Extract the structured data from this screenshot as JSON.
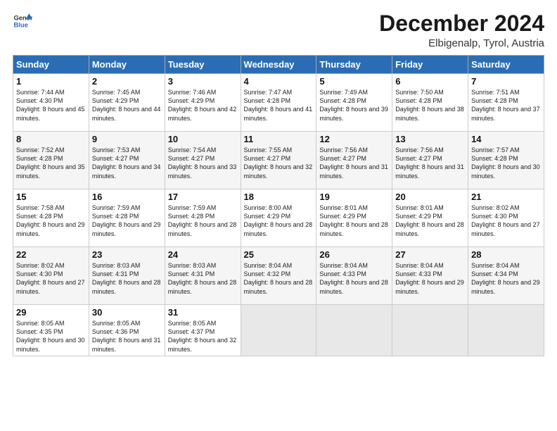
{
  "logo": {
    "line1": "General",
    "line2": "Blue"
  },
  "title": "December 2024",
  "location": "Elbigenalp, Tyrol, Austria",
  "weekdays": [
    "Sunday",
    "Monday",
    "Tuesday",
    "Wednesday",
    "Thursday",
    "Friday",
    "Saturday"
  ],
  "weeks": [
    [
      {
        "day": "1",
        "sunrise": "Sunrise: 7:44 AM",
        "sunset": "Sunset: 4:30 PM",
        "daylight": "Daylight: 8 hours and 45 minutes."
      },
      {
        "day": "2",
        "sunrise": "Sunrise: 7:45 AM",
        "sunset": "Sunset: 4:29 PM",
        "daylight": "Daylight: 8 hours and 44 minutes."
      },
      {
        "day": "3",
        "sunrise": "Sunrise: 7:46 AM",
        "sunset": "Sunset: 4:29 PM",
        "daylight": "Daylight: 8 hours and 42 minutes."
      },
      {
        "day": "4",
        "sunrise": "Sunrise: 7:47 AM",
        "sunset": "Sunset: 4:28 PM",
        "daylight": "Daylight: 8 hours and 41 minutes."
      },
      {
        "day": "5",
        "sunrise": "Sunrise: 7:49 AM",
        "sunset": "Sunset: 4:28 PM",
        "daylight": "Daylight: 8 hours and 39 minutes."
      },
      {
        "day": "6",
        "sunrise": "Sunrise: 7:50 AM",
        "sunset": "Sunset: 4:28 PM",
        "daylight": "Daylight: 8 hours and 38 minutes."
      },
      {
        "day": "7",
        "sunrise": "Sunrise: 7:51 AM",
        "sunset": "Sunset: 4:28 PM",
        "daylight": "Daylight: 8 hours and 37 minutes."
      }
    ],
    [
      {
        "day": "8",
        "sunrise": "Sunrise: 7:52 AM",
        "sunset": "Sunset: 4:28 PM",
        "daylight": "Daylight: 8 hours and 35 minutes."
      },
      {
        "day": "9",
        "sunrise": "Sunrise: 7:53 AM",
        "sunset": "Sunset: 4:27 PM",
        "daylight": "Daylight: 8 hours and 34 minutes."
      },
      {
        "day": "10",
        "sunrise": "Sunrise: 7:54 AM",
        "sunset": "Sunset: 4:27 PM",
        "daylight": "Daylight: 8 hours and 33 minutes."
      },
      {
        "day": "11",
        "sunrise": "Sunrise: 7:55 AM",
        "sunset": "Sunset: 4:27 PM",
        "daylight": "Daylight: 8 hours and 32 minutes."
      },
      {
        "day": "12",
        "sunrise": "Sunrise: 7:56 AM",
        "sunset": "Sunset: 4:27 PM",
        "daylight": "Daylight: 8 hours and 31 minutes."
      },
      {
        "day": "13",
        "sunrise": "Sunrise: 7:56 AM",
        "sunset": "Sunset: 4:27 PM",
        "daylight": "Daylight: 8 hours and 31 minutes."
      },
      {
        "day": "14",
        "sunrise": "Sunrise: 7:57 AM",
        "sunset": "Sunset: 4:28 PM",
        "daylight": "Daylight: 8 hours and 30 minutes."
      }
    ],
    [
      {
        "day": "15",
        "sunrise": "Sunrise: 7:58 AM",
        "sunset": "Sunset: 4:28 PM",
        "daylight": "Daylight: 8 hours and 29 minutes."
      },
      {
        "day": "16",
        "sunrise": "Sunrise: 7:59 AM",
        "sunset": "Sunset: 4:28 PM",
        "daylight": "Daylight: 8 hours and 29 minutes."
      },
      {
        "day": "17",
        "sunrise": "Sunrise: 7:59 AM",
        "sunset": "Sunset: 4:28 PM",
        "daylight": "Daylight: 8 hours and 28 minutes."
      },
      {
        "day": "18",
        "sunrise": "Sunrise: 8:00 AM",
        "sunset": "Sunset: 4:29 PM",
        "daylight": "Daylight: 8 hours and 28 minutes."
      },
      {
        "day": "19",
        "sunrise": "Sunrise: 8:01 AM",
        "sunset": "Sunset: 4:29 PM",
        "daylight": "Daylight: 8 hours and 28 minutes."
      },
      {
        "day": "20",
        "sunrise": "Sunrise: 8:01 AM",
        "sunset": "Sunset: 4:29 PM",
        "daylight": "Daylight: 8 hours and 28 minutes."
      },
      {
        "day": "21",
        "sunrise": "Sunrise: 8:02 AM",
        "sunset": "Sunset: 4:30 PM",
        "daylight": "Daylight: 8 hours and 27 minutes."
      }
    ],
    [
      {
        "day": "22",
        "sunrise": "Sunrise: 8:02 AM",
        "sunset": "Sunset: 4:30 PM",
        "daylight": "Daylight: 8 hours and 27 minutes."
      },
      {
        "day": "23",
        "sunrise": "Sunrise: 8:03 AM",
        "sunset": "Sunset: 4:31 PM",
        "daylight": "Daylight: 8 hours and 28 minutes."
      },
      {
        "day": "24",
        "sunrise": "Sunrise: 8:03 AM",
        "sunset": "Sunset: 4:31 PM",
        "daylight": "Daylight: 8 hours and 28 minutes."
      },
      {
        "day": "25",
        "sunrise": "Sunrise: 8:04 AM",
        "sunset": "Sunset: 4:32 PM",
        "daylight": "Daylight: 8 hours and 28 minutes."
      },
      {
        "day": "26",
        "sunrise": "Sunrise: 8:04 AM",
        "sunset": "Sunset: 4:33 PM",
        "daylight": "Daylight: 8 hours and 28 minutes."
      },
      {
        "day": "27",
        "sunrise": "Sunrise: 8:04 AM",
        "sunset": "Sunset: 4:33 PM",
        "daylight": "Daylight: 8 hours and 29 minutes."
      },
      {
        "day": "28",
        "sunrise": "Sunrise: 8:04 AM",
        "sunset": "Sunset: 4:34 PM",
        "daylight": "Daylight: 8 hours and 29 minutes."
      }
    ],
    [
      {
        "day": "29",
        "sunrise": "Sunrise: 8:05 AM",
        "sunset": "Sunset: 4:35 PM",
        "daylight": "Daylight: 8 hours and 30 minutes."
      },
      {
        "day": "30",
        "sunrise": "Sunrise: 8:05 AM",
        "sunset": "Sunset: 4:36 PM",
        "daylight": "Daylight: 8 hours and 31 minutes."
      },
      {
        "day": "31",
        "sunrise": "Sunrise: 8:05 AM",
        "sunset": "Sunset: 4:37 PM",
        "daylight": "Daylight: 8 hours and 32 minutes."
      },
      null,
      null,
      null,
      null
    ]
  ]
}
